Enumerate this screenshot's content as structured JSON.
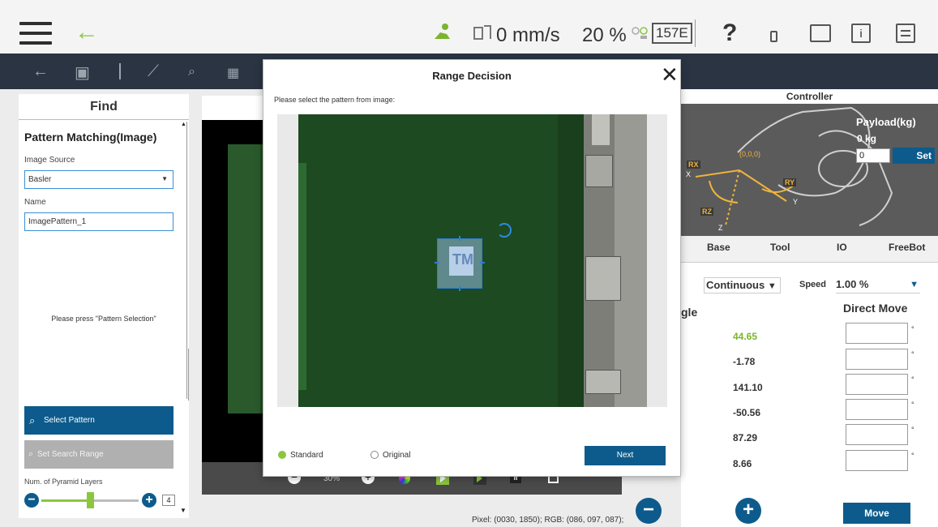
{
  "topbar": {
    "speed": "0 mm/s",
    "percent": "20 %",
    "mode_code": "157E"
  },
  "left_panel": {
    "title": "Find",
    "section_title": "Pattern Matching(Image)",
    "image_source_label": "Image Source",
    "image_source_value": "Basler",
    "name_label": "Name",
    "name_value": "ImagePattern_1",
    "instruction": "Please press \"Pattern Selection\"",
    "select_pattern_label": "Select Pattern",
    "set_search_range_label": "Set Search Range",
    "pyramid_label": "Num. of Pyramid Layers",
    "pyramid_value": "4",
    "pyramid_level_fraction": 0.47
  },
  "mid": {
    "zoom": "30%",
    "pixel_info": "Pixel: (0030, 1850); RGB: (086, 097, 087);"
  },
  "modal": {
    "title": "Range Decision",
    "subtitle": "Please select the pattern from image:",
    "radio_standard": "Standard",
    "radio_original": "Original",
    "next_label": "Next",
    "logo_text": "TM"
  },
  "right_panel": {
    "controller_title": "Controller",
    "payload_label": "Payload(kg)",
    "payload_value": "0 kg",
    "payload_input": "0",
    "set_label": "Set",
    "axis_labels": [
      "RX",
      "RY",
      "RZ",
      "(0,0,0)",
      "X",
      "Y",
      "Z"
    ],
    "tabs": [
      "Base",
      "Tool",
      "IO",
      "FreeBot"
    ],
    "mode": "Continuous",
    "speed_label": "Speed",
    "speed_value": "1.00 %",
    "angle_label": "gle",
    "direct_move_label": "Direct Move",
    "joints": [
      "44.65",
      "-1.78",
      "141.10",
      "-50.56",
      "87.29",
      "8.66"
    ],
    "degree_symbol": "°",
    "move_label": "Move"
  },
  "colors": {
    "accent_green": "#8cc63f",
    "primary_blue": "#0d5b8c",
    "toolbar_dark": "#2a3443"
  }
}
